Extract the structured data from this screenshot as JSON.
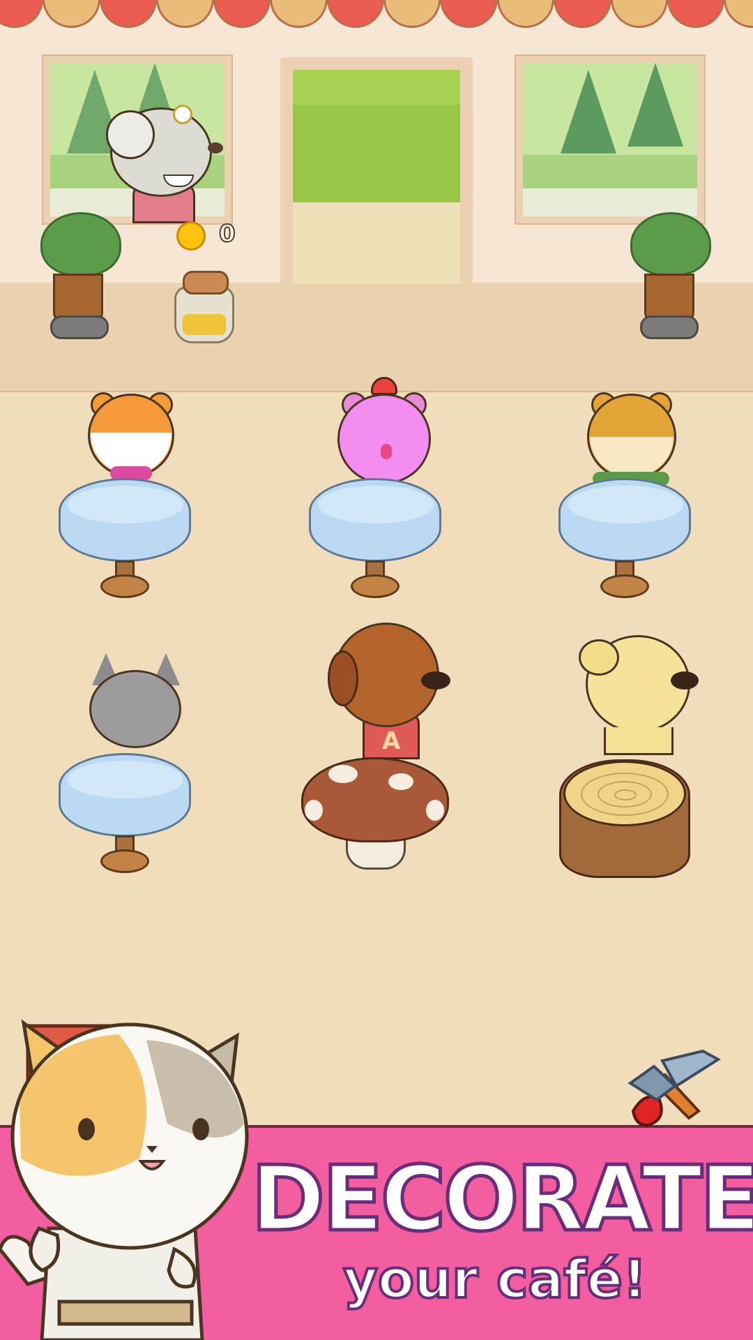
{
  "hud": {
    "coin_count": "0",
    "coin_icon": "paw-coin-icon"
  },
  "scene": {
    "customers": [
      "hamster-orange",
      "hamster-pink",
      "hamster-brown",
      "cat-gray",
      "dog-brown",
      "dog-yellow"
    ],
    "seats": [
      "table",
      "table",
      "table",
      "table",
      "mushroom-seat",
      "tree-stump-seat"
    ],
    "dog_shirt_letter": "A"
  },
  "banner": {
    "headline": "DECORATE",
    "subline": "your café!"
  },
  "colors": {
    "awning_red": "#ea5c52",
    "awning_tan": "#e9bd79",
    "banner_pink": "#f25ea0",
    "text_outline": "#6a2d7a"
  },
  "icons": {
    "tools": "hammer-saw-icon"
  }
}
